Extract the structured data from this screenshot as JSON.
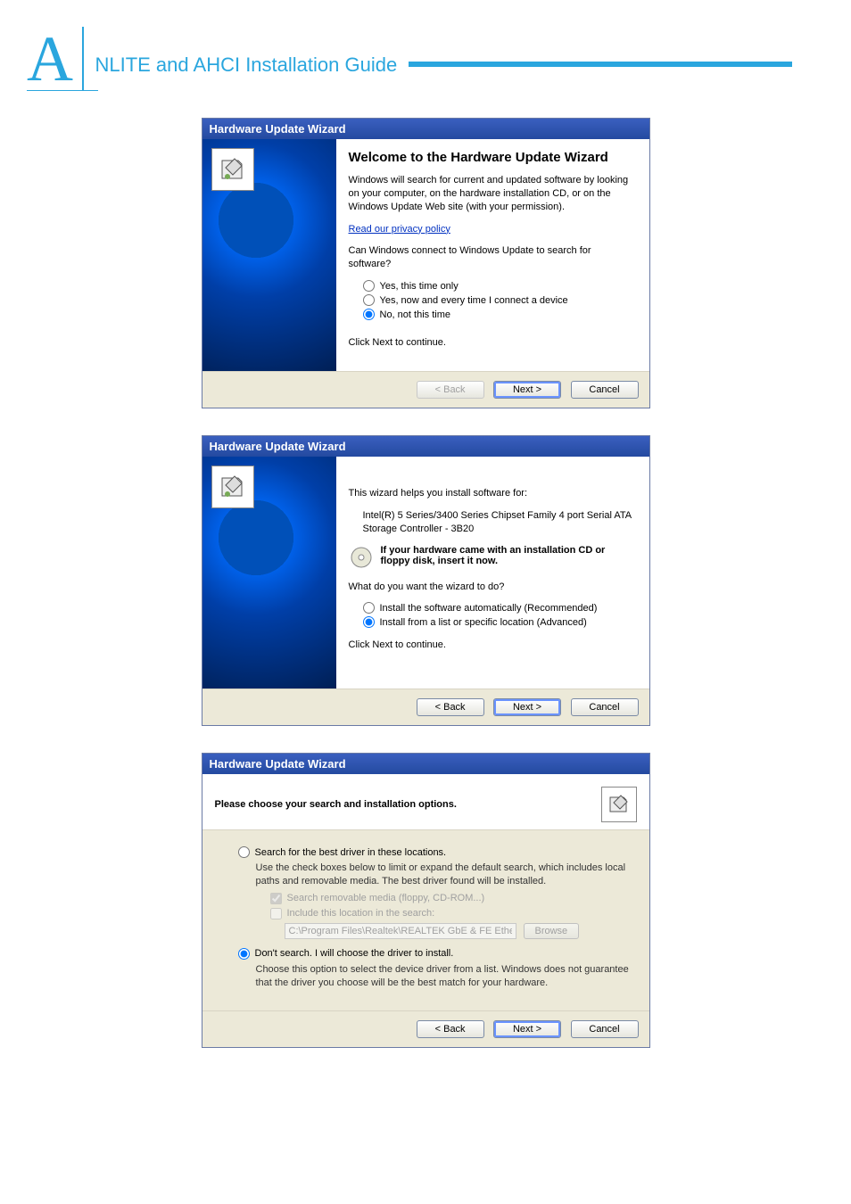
{
  "header": {
    "letter": "A",
    "title": "NLITE and AHCI Installation Guide"
  },
  "dialogs": [
    {
      "title": "Hardware Update Wizard",
      "heading": "Welcome to the Hardware Update Wizard",
      "intro": "Windows will search for current and updated software by looking on your computer, on the hardware installation CD, or on the Windows Update Web site (with your permission).",
      "privacy_link": "Read our privacy policy",
      "question": "Can Windows connect to Windows Update to search for software?",
      "options": [
        "Yes, this time only",
        "Yes, now and every time I connect a device",
        "No, not this time"
      ],
      "selected": 2,
      "continue_hint": "Click Next to continue.",
      "buttons": {
        "back": "< Back",
        "next": "Next >",
        "cancel": "Cancel"
      }
    },
    {
      "title": "Hardware Update Wizard",
      "intro": "This wizard helps you install software for:",
      "device": "Intel(R) 5 Series/3400 Series Chipset Family 4 port Serial ATA Storage Controller - 3B20",
      "cd_hint": "If your hardware came with an installation CD or floppy disk, insert it now.",
      "question": "What do you want the wizard to do?",
      "options": [
        "Install the software automatically (Recommended)",
        "Install from a list or specific location (Advanced)"
      ],
      "selected": 1,
      "continue_hint": "Click Next to continue.",
      "buttons": {
        "back": "< Back",
        "next": "Next >",
        "cancel": "Cancel"
      }
    },
    {
      "title": "Hardware Update Wizard",
      "heading": "Please choose your search and installation options.",
      "opt_search": "Search for the best driver in these locations.",
      "opt_search_desc": "Use the check boxes below to limit or expand the default search, which includes local paths and removable media. The best driver found will be installed.",
      "chk_removable": "Search removable media (floppy, CD-ROM...)",
      "chk_include": "Include this location in the search:",
      "path_value": "C:\\Program Files\\Realtek\\REALTEK GbE & FE Ethe",
      "browse_label": "Browse",
      "opt_dont": "Don't search. I will choose the driver to install.",
      "opt_dont_desc": "Choose this option to select the device driver from a list.  Windows does not guarantee that the driver you choose will be the best match for your hardware.",
      "selected": 1,
      "buttons": {
        "back": "< Back",
        "next": "Next >",
        "cancel": "Cancel"
      }
    }
  ]
}
